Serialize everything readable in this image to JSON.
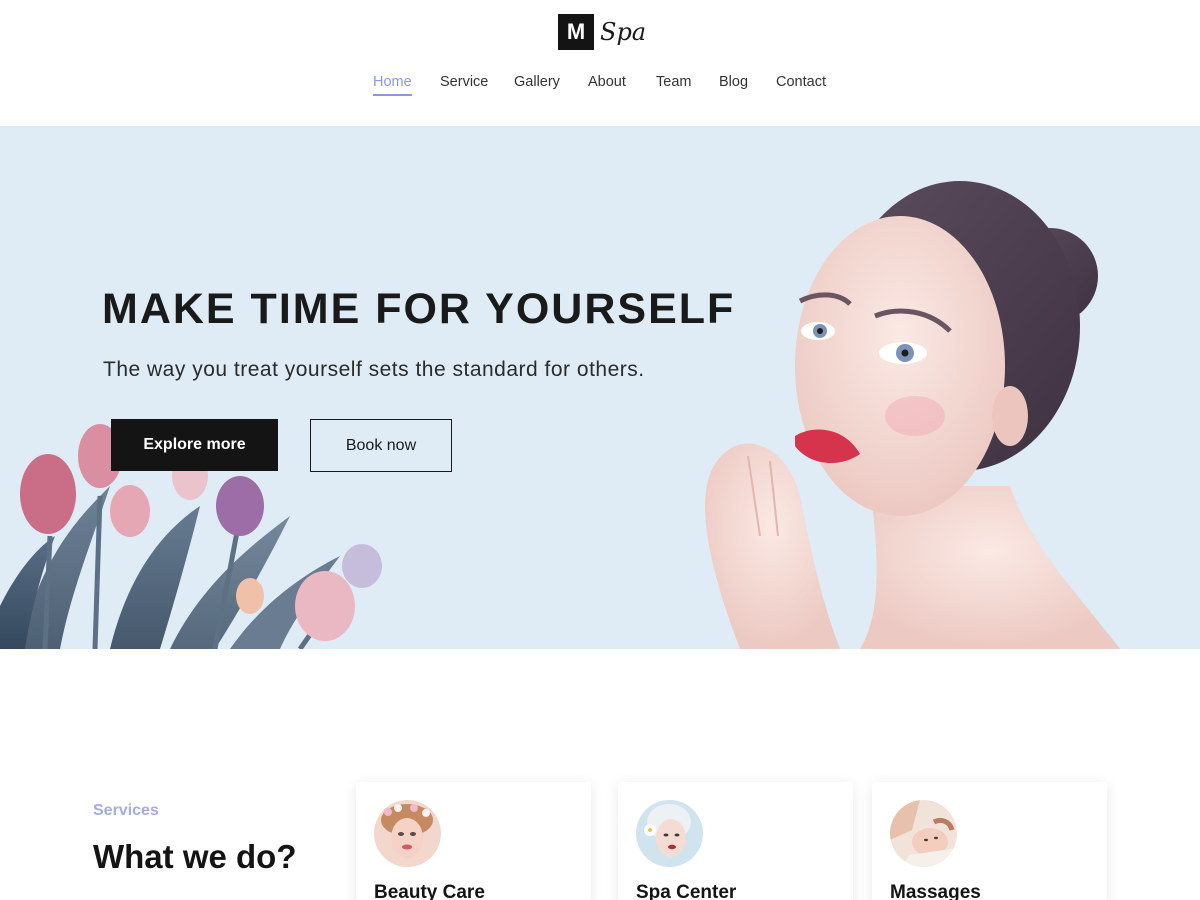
{
  "brand": {
    "mark": "M",
    "name": "Spa"
  },
  "nav": {
    "items": [
      {
        "label": "Home",
        "active": true
      },
      {
        "label": "Service",
        "active": false
      },
      {
        "label": "Gallery",
        "active": false
      },
      {
        "label": "About",
        "active": false
      },
      {
        "label": "Team",
        "active": false
      },
      {
        "label": "Blog",
        "active": false
      },
      {
        "label": "Contact",
        "active": false
      }
    ]
  },
  "hero": {
    "title": "MAKE TIME FOR YOURSELF",
    "subtitle": "The way you treat yourself sets the standard for others.",
    "primary_button": "Explore more",
    "secondary_button": "Book now",
    "images": [
      "tulip-flowers-image",
      "woman-portrait-image"
    ]
  },
  "services": {
    "kicker": "Services",
    "title": "What we do?",
    "cards": [
      {
        "title": "Beauty Care",
        "icon": "beauty-care-avatar"
      },
      {
        "title": "Spa Center",
        "icon": "spa-center-avatar"
      },
      {
        "title": "Massages",
        "icon": "massage-avatar"
      }
    ]
  },
  "colors": {
    "accent": "#8e96e0",
    "hero_bg": "#dfecf6",
    "dark": "#141414"
  }
}
